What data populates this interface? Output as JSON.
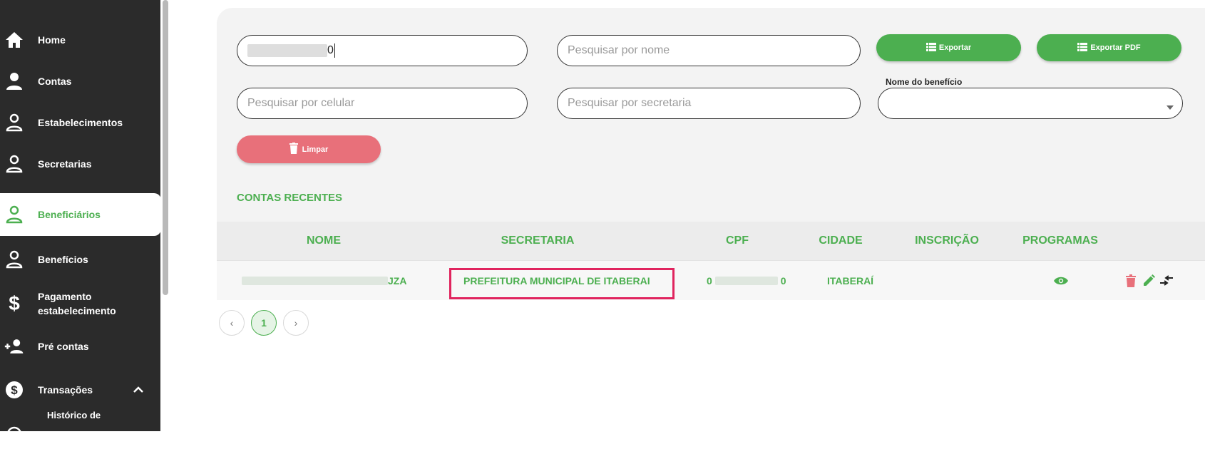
{
  "sidebar": {
    "items": [
      {
        "label": "Home",
        "icon": "home-icon"
      },
      {
        "label": "Contas",
        "icon": "user-icon"
      },
      {
        "label": "Estabelecimentos",
        "icon": "user-outline-icon"
      },
      {
        "label": "Secretarias",
        "icon": "user-outline-icon"
      },
      {
        "label": "Beneficiários",
        "icon": "user-outline-icon",
        "active": true
      },
      {
        "label": "Benefícios",
        "icon": "user-outline-icon"
      },
      {
        "label": "Pagamento estabelecimento",
        "icon": "dollar-icon"
      },
      {
        "label": "Pré contas",
        "icon": "add-user-icon"
      },
      {
        "label": "Transações",
        "icon": "dollar-circle-icon",
        "expanded": true
      },
      {
        "label": "Histórico de",
        "icon": "history-icon"
      }
    ]
  },
  "filters": {
    "cpf_value_suffix": "0",
    "name_placeholder": "Pesquisar por nome",
    "phone_placeholder": "Pesquisar por celular",
    "secretaria_placeholder": "Pesquisar por secretaria",
    "export_label": "Exportar",
    "export_pdf_label": "Exportar PDF",
    "benefit_label": "Nome do benefício",
    "benefit_value": "",
    "clear_label": "Limpar"
  },
  "section_title": "CONTAS RECENTES",
  "table": {
    "headers": [
      "NOME",
      "SECRETARIA",
      "CPF",
      "CIDADE",
      "INSCRIÇÃO",
      "PROGRAMAS"
    ],
    "rows": [
      {
        "nome_suffix": "JZA",
        "secretaria": "PREFEITURA MUNICIPAL DE ITABERAI",
        "cpf_prefix": "0",
        "cpf_suffix": "0",
        "cidade": "ITABERAÍ",
        "inscricao": ""
      }
    ]
  },
  "pagination": {
    "prev": "‹",
    "current": "1",
    "next": "›"
  },
  "colors": {
    "accent": "#4caf50",
    "danger": "#e8707a",
    "sidebar": "#2b2b2b",
    "highlight": "#e0245e"
  }
}
